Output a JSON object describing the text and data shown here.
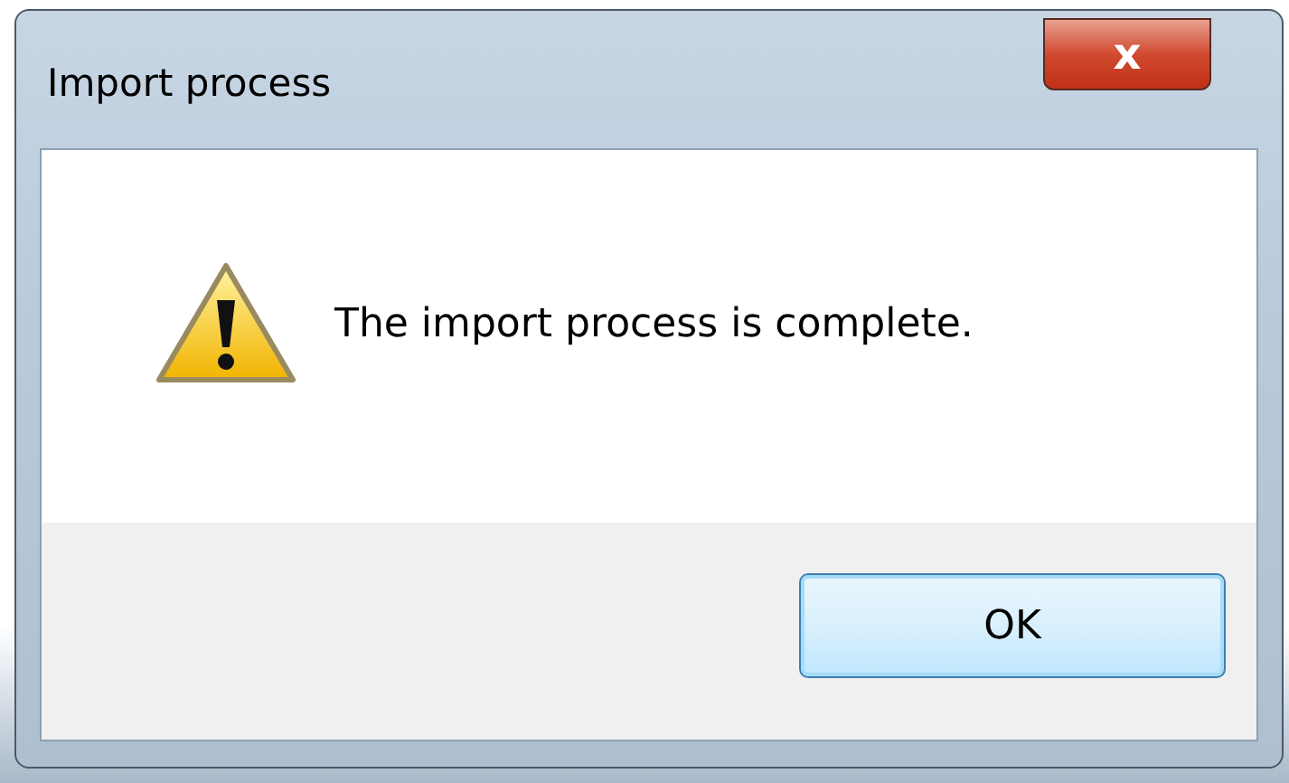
{
  "window": {
    "title": "Import process",
    "close": "x"
  },
  "message": "The import process is complete.",
  "buttons": [
    {
      "label": "OK",
      "selected": true
    }
  ]
}
